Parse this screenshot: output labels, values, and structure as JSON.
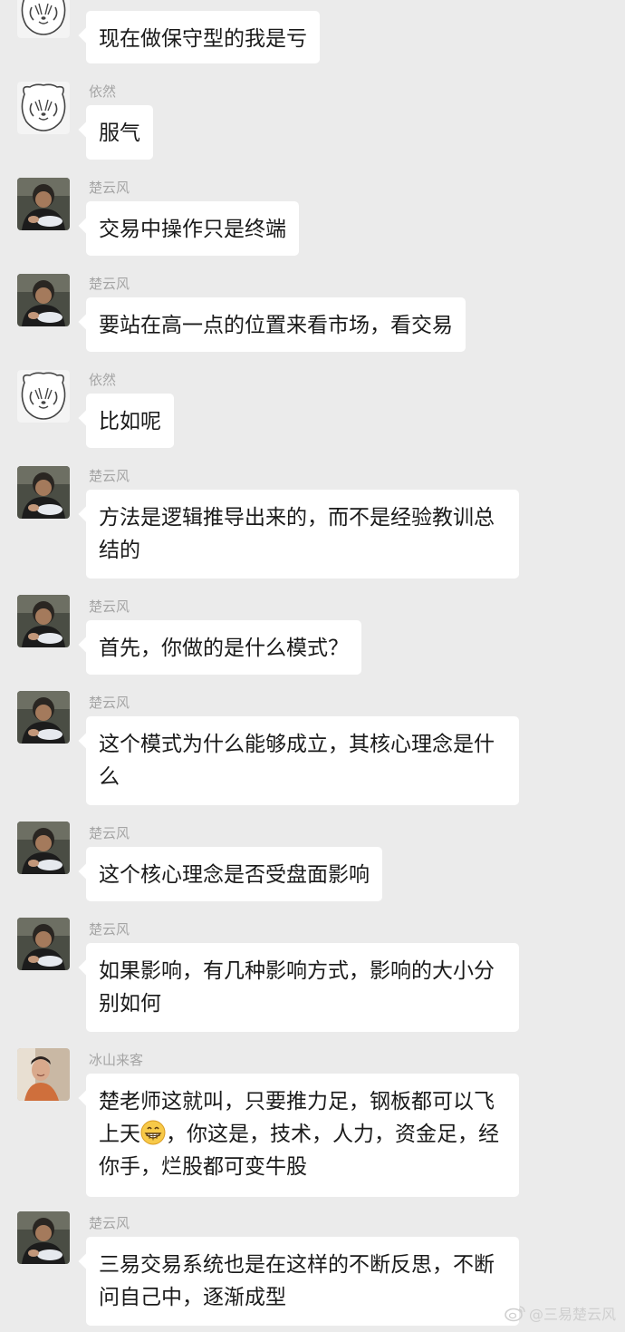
{
  "messages": [
    {
      "sender": "",
      "avatar": "bear-cartoon-avatar",
      "text": "现在做保守型的我是亏"
    },
    {
      "sender": "依然",
      "avatar": "bear-cartoon-avatar",
      "text": "服气"
    },
    {
      "sender": "楚云风",
      "avatar": "man-photo-avatar",
      "text": "交易中操作只是终端"
    },
    {
      "sender": "楚云风",
      "avatar": "man-photo-avatar",
      "text": "要站在高一点的位置来看市场，看交易"
    },
    {
      "sender": "依然",
      "avatar": "bear-cartoon-avatar",
      "text": "比如呢"
    },
    {
      "sender": "楚云风",
      "avatar": "man-photo-avatar",
      "text": "方法是逻辑推导出来的，而不是经验教训总结的"
    },
    {
      "sender": "楚云风",
      "avatar": "man-photo-avatar",
      "text": "首先，你做的是什么模式？"
    },
    {
      "sender": "楚云风",
      "avatar": "man-photo-avatar",
      "text": "这个模式为什么能够成立，其核心理念是什么"
    },
    {
      "sender": "楚云风",
      "avatar": "man-photo-avatar",
      "text": "这个核心理念是否受盘面影响"
    },
    {
      "sender": "楚云风",
      "avatar": "man-photo-avatar",
      "text": "如果影响，有几种影响方式，影响的大小分别如何"
    },
    {
      "sender": "冰山来客",
      "avatar": "person-photo-avatar",
      "text_before_emoji": "楚老师这就叫，只要推力足，钢板都可以飞上天",
      "emoji": "grinning-face-emoji",
      "text_after_emoji": "，你这是，技术，人力，资金足，经你手，烂股都可变牛股"
    },
    {
      "sender": "楚云风",
      "avatar": "man-photo-avatar",
      "text": "三易交易系统也是在这样的不断反思，不断问自己中，逐渐成型"
    }
  ],
  "watermark": {
    "icon": "weibo-icon",
    "text": "@三易楚云风"
  },
  "colors": {
    "background": "#ebebeb",
    "bubble": "#ffffff",
    "sender_name": "#a5a5a5",
    "text": "#1a1a1a"
  }
}
